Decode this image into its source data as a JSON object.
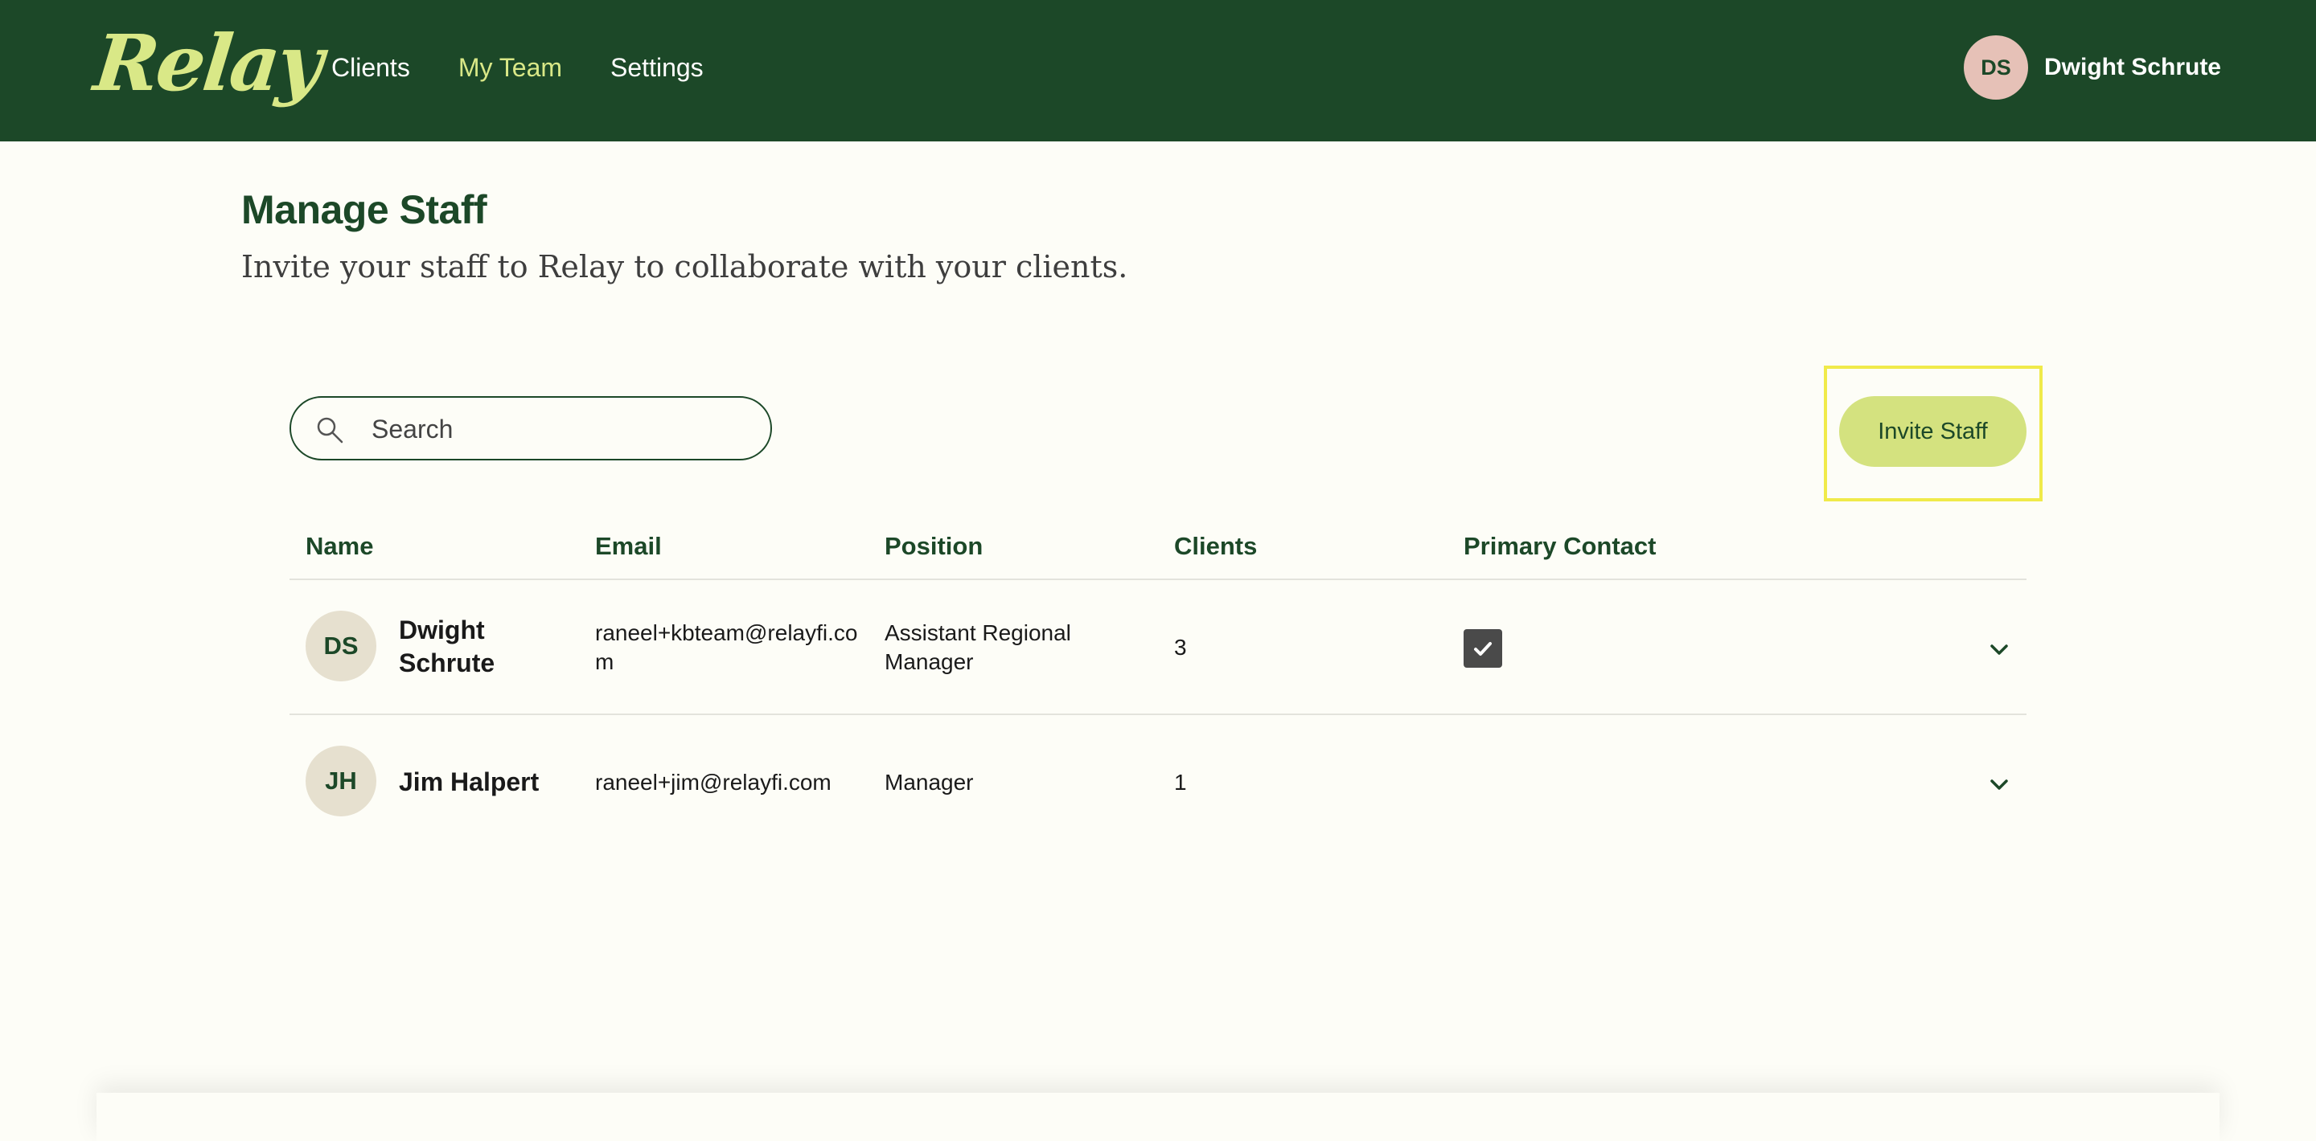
{
  "brand": {
    "logo_text": "Relay"
  },
  "nav": {
    "items": [
      {
        "label": "Clients",
        "active": false
      },
      {
        "label": "My Team",
        "active": true
      },
      {
        "label": "Settings",
        "active": false
      }
    ]
  },
  "user": {
    "initials": "DS",
    "name": "Dwight Schrute"
  },
  "page": {
    "title": "Manage Staff",
    "subtitle": "Invite your staff to Relay to collaborate with your clients."
  },
  "search": {
    "placeholder": "Search",
    "value": ""
  },
  "invite_button": {
    "label": "Invite Staff"
  },
  "table": {
    "headers": {
      "name": "Name",
      "email": "Email",
      "position": "Position",
      "clients": "Clients",
      "primary_contact": "Primary Contact"
    },
    "rows": [
      {
        "initials": "DS",
        "name": "Dwight Schrute",
        "email": "raneel+kbteam@relayfi.com",
        "position": "Assistant Regional Manager",
        "clients": "3",
        "primary_contact": true
      },
      {
        "initials": "JH",
        "name": "Jim Halpert",
        "email": "raneel+jim@relayfi.com",
        "position": "Manager",
        "clients": "1",
        "primary_contact": false
      }
    ]
  },
  "colors": {
    "header_bg": "#1c4828",
    "accent_lime": "#d9e887",
    "button_bg": "#d4e27f",
    "highlight": "#f0ea4a",
    "page_bg": "#fdfdf7"
  },
  "icons": {
    "search": "search-icon",
    "check": "check-icon",
    "expand": "chevron-down-icon"
  }
}
